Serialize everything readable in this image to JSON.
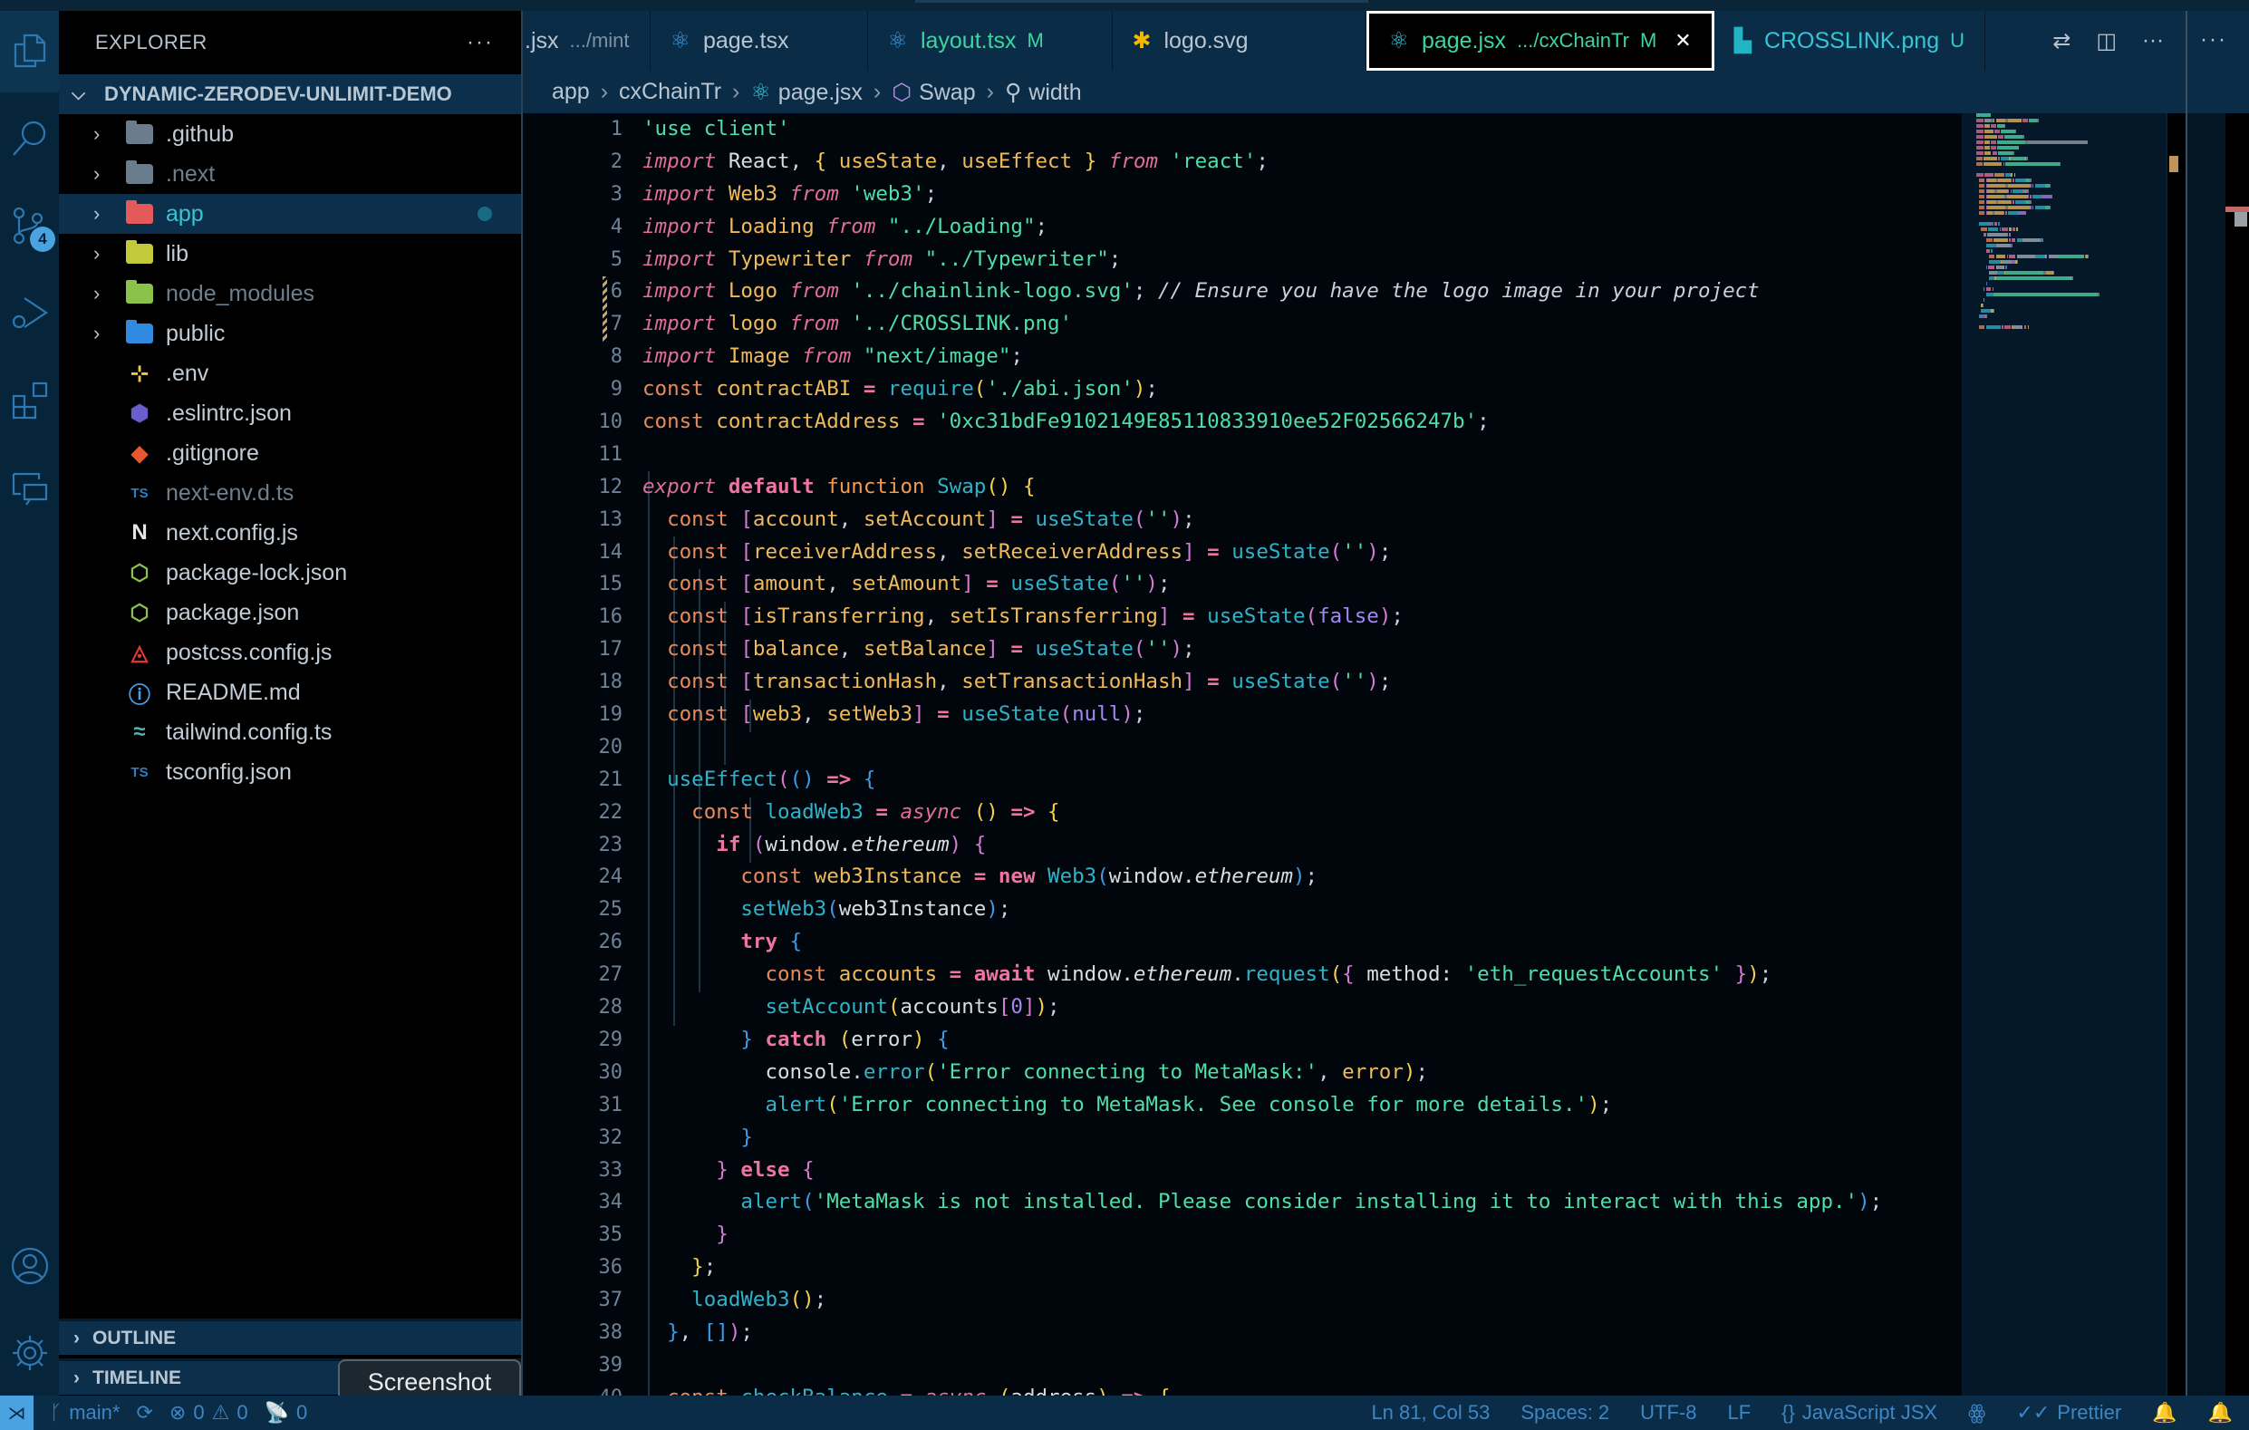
{
  "activity_bar": {
    "items": [
      {
        "name": "explorer",
        "active": true
      },
      {
        "name": "search",
        "active": false
      },
      {
        "name": "source-control",
        "active": false,
        "badge": "4"
      },
      {
        "name": "run-debug",
        "active": false
      },
      {
        "name": "extensions",
        "active": false
      },
      {
        "name": "remote-explorer",
        "active": false
      }
    ],
    "bottom": [
      "accounts",
      "manage"
    ]
  },
  "sidebar": {
    "title": "EXPLORER",
    "more": "···",
    "project": "DYNAMIC-ZERODEV-UNLIMIT-DEMO",
    "tree": [
      {
        "name": ".github",
        "type": "folder",
        "icon": "github-folder-icon",
        "color": "#6b7d8c",
        "dim": false
      },
      {
        "name": ".next",
        "type": "folder",
        "icon": "next-folder-icon",
        "color": "#6b7d8c",
        "dim": true
      },
      {
        "name": "app",
        "type": "folder",
        "icon": "app-folder-icon",
        "color": "#e45a5a",
        "selected": true,
        "modified_dot": true
      },
      {
        "name": "lib",
        "type": "folder",
        "icon": "lib-folder-icon",
        "color": "#c2c93a"
      },
      {
        "name": "node_modules",
        "type": "folder",
        "icon": "node-folder-icon",
        "color": "#8bc34a",
        "dim": true
      },
      {
        "name": "public",
        "type": "folder",
        "icon": "public-folder-icon",
        "color": "#2f8ae0"
      },
      {
        "name": ".env",
        "type": "file",
        "icon": "env-icon",
        "color": "#f5c542"
      },
      {
        "name": ".eslintrc.json",
        "type": "file",
        "icon": "eslint-icon",
        "color": "#6a5ecf"
      },
      {
        "name": ".gitignore",
        "type": "file",
        "icon": "git-icon",
        "color": "#e8572d"
      },
      {
        "name": "next-env.d.ts",
        "type": "file",
        "icon": "typescript-icon",
        "color": "#2f7fc1",
        "dim": true
      },
      {
        "name": "next.config.js",
        "type": "file",
        "icon": "nextjs-icon",
        "color": "#e6e6e6"
      },
      {
        "name": "package-lock.json",
        "type": "file",
        "icon": "nodejs-icon",
        "color": "#8bc34a"
      },
      {
        "name": "package.json",
        "type": "file",
        "icon": "nodejs-icon",
        "color": "#8bc34a"
      },
      {
        "name": "postcss.config.js",
        "type": "file",
        "icon": "postcss-icon",
        "color": "#e53935"
      },
      {
        "name": "README.md",
        "type": "file",
        "icon": "info-icon",
        "color": "#42a5f5"
      },
      {
        "name": "tailwind.config.ts",
        "type": "file",
        "icon": "tailwind-icon",
        "color": "#4db6ac"
      },
      {
        "name": "tsconfig.json",
        "type": "file",
        "icon": "tsconfig-icon",
        "color": "#2f7fc1"
      }
    ],
    "sections": [
      "OUTLINE",
      "TIMELINE"
    ]
  },
  "tabs": [
    {
      "label": ".jsx",
      "desc": ".../mint",
      "icon": "none",
      "color": "#b9c5d0"
    },
    {
      "label": "page.tsx",
      "desc": "",
      "icon": "react-icon",
      "color": "#b9c5d0"
    },
    {
      "label": "layout.tsx",
      "desc": "",
      "mark": "M",
      "icon": "react-icon",
      "color": "#3ed4a0"
    },
    {
      "label": "logo.svg",
      "desc": "",
      "icon": "svg-icon",
      "color": "#b9c5d0"
    },
    {
      "label": "page.jsx",
      "desc": ".../cxChainTr",
      "mark": "M",
      "icon": "react-icon",
      "color": "#3ed4a0",
      "active": true,
      "close": "✕"
    },
    {
      "label": "CROSSLINK.png",
      "desc": "",
      "mark": "U",
      "icon": "image-icon",
      "color": "#37c5d6"
    }
  ],
  "breadcrumb": [
    {
      "label": "app",
      "icon": null
    },
    {
      "label": "cxChainTr",
      "icon": null
    },
    {
      "label": "page.jsx",
      "icon": "react-icon"
    },
    {
      "label": "Swap",
      "icon": "cube-icon"
    },
    {
      "label": "width",
      "icon": "wrench-icon"
    }
  ],
  "editor": {
    "first_line": 1,
    "lines": [
      [
        [
          "str",
          "'use client'"
        ]
      ],
      [
        [
          "k-imp",
          "import"
        ],
        [
          "plain",
          " React"
        ],
        [
          "pun",
          ", "
        ],
        [
          "br1",
          "{"
        ],
        [
          "var",
          " useState"
        ],
        [
          "pun",
          ", "
        ],
        [
          "var",
          "useEffect "
        ],
        [
          "br1",
          "}"
        ],
        [
          "k-imp",
          " from"
        ],
        [
          "str",
          " 'react'"
        ],
        [
          "pun",
          ";"
        ]
      ],
      [
        [
          "k-imp",
          "import"
        ],
        [
          "var",
          " Web3"
        ],
        [
          "k-imp",
          " from"
        ],
        [
          "str",
          " 'web3'"
        ],
        [
          "pun",
          ";"
        ]
      ],
      [
        [
          "k-imp",
          "import"
        ],
        [
          "var",
          " Loading"
        ],
        [
          "k-imp",
          " from"
        ],
        [
          "str",
          " \"../Loading\""
        ],
        [
          "pun",
          ";"
        ]
      ],
      [
        [
          "k-imp",
          "import"
        ],
        [
          "var",
          " Typewriter"
        ],
        [
          "k-imp",
          " from"
        ],
        [
          "str",
          " \"../Typewriter\""
        ],
        [
          "pun",
          ";"
        ]
      ],
      [
        [
          "k-imp",
          "import"
        ],
        [
          "var",
          " Logo"
        ],
        [
          "k-imp",
          " from"
        ],
        [
          "str",
          " '../chainlink-logo.svg'"
        ],
        [
          "pun",
          "; "
        ],
        [
          "cmt",
          "// Ensure you have the logo image in your project"
        ]
      ],
      [
        [
          "k-imp",
          "import"
        ],
        [
          "var",
          " logo"
        ],
        [
          "k-imp",
          " from"
        ],
        [
          "str",
          " '../CROSSLINK.png'"
        ]
      ],
      [
        [
          "k-imp",
          "import"
        ],
        [
          "var",
          " Image"
        ],
        [
          "k-imp",
          " from"
        ],
        [
          "str",
          " \"next/image\""
        ],
        [
          "pun",
          ";"
        ]
      ],
      [
        [
          "k-const",
          "const"
        ],
        [
          "var",
          " contractABI"
        ],
        [
          "k-bold",
          " ="
        ],
        [
          "fn",
          " require"
        ],
        [
          "br1",
          "("
        ],
        [
          "str",
          "'./abi.json'"
        ],
        [
          "br1",
          ")"
        ],
        [
          "pun",
          ";"
        ]
      ],
      [
        [
          "k-const",
          "const"
        ],
        [
          "var",
          " contractAddress"
        ],
        [
          "k-bold",
          " ="
        ],
        [
          "str",
          " '0xc31bdFe9102149E85110833910ee52F02566247b'"
        ],
        [
          "pun",
          ";"
        ]
      ],
      [],
      [
        [
          "k-imp",
          "export"
        ],
        [
          "k-bold",
          " default"
        ],
        [
          "k-fn",
          " function"
        ],
        [
          "cls",
          " Swap"
        ],
        [
          "br1",
          "()"
        ],
        [
          "br1",
          " {"
        ]
      ],
      [
        [
          "k-const",
          "  const"
        ],
        [
          "br2",
          " ["
        ],
        [
          "var",
          "account"
        ],
        [
          "pun",
          ", "
        ],
        [
          "var",
          "setAccount"
        ],
        [
          "br2",
          "]"
        ],
        [
          "k-bold",
          " ="
        ],
        [
          "fn",
          " useState"
        ],
        [
          "br2",
          "("
        ],
        [
          "str",
          "''"
        ],
        [
          "br2",
          ")"
        ],
        [
          "pun",
          ";"
        ]
      ],
      [
        [
          "k-const",
          "  const"
        ],
        [
          "br2",
          " ["
        ],
        [
          "var",
          "receiverAddress"
        ],
        [
          "pun",
          ", "
        ],
        [
          "var",
          "setReceiverAddress"
        ],
        [
          "br2",
          "]"
        ],
        [
          "k-bold",
          " ="
        ],
        [
          "fn",
          " useState"
        ],
        [
          "br2",
          "("
        ],
        [
          "str",
          "''"
        ],
        [
          "br2",
          ")"
        ],
        [
          "pun",
          ";"
        ]
      ],
      [
        [
          "k-const",
          "  const"
        ],
        [
          "br2",
          " ["
        ],
        [
          "var",
          "amount"
        ],
        [
          "pun",
          ", "
        ],
        [
          "var",
          "setAmount"
        ],
        [
          "br2",
          "]"
        ],
        [
          "k-bold",
          " ="
        ],
        [
          "fn",
          " useState"
        ],
        [
          "br2",
          "("
        ],
        [
          "str",
          "''"
        ],
        [
          "br2",
          ")"
        ],
        [
          "pun",
          ";"
        ]
      ],
      [
        [
          "k-const",
          "  const"
        ],
        [
          "br2",
          " ["
        ],
        [
          "var",
          "isTransferring"
        ],
        [
          "pun",
          ", "
        ],
        [
          "var",
          "setIsTransferring"
        ],
        [
          "br2",
          "]"
        ],
        [
          "k-bold",
          " ="
        ],
        [
          "fn",
          " useState"
        ],
        [
          "br2",
          "("
        ],
        [
          "num",
          "false"
        ],
        [
          "br2",
          ")"
        ],
        [
          "pun",
          ";"
        ]
      ],
      [
        [
          "k-const",
          "  const"
        ],
        [
          "br2",
          " ["
        ],
        [
          "var",
          "balance"
        ],
        [
          "pun",
          ", "
        ],
        [
          "var",
          "setBalance"
        ],
        [
          "br2",
          "]"
        ],
        [
          "k-bold",
          " ="
        ],
        [
          "fn",
          " useState"
        ],
        [
          "br2",
          "("
        ],
        [
          "str",
          "''"
        ],
        [
          "br2",
          ")"
        ],
        [
          "pun",
          ";"
        ]
      ],
      [
        [
          "k-const",
          "  const"
        ],
        [
          "br2",
          " ["
        ],
        [
          "var",
          "transactionHash"
        ],
        [
          "pun",
          ", "
        ],
        [
          "var",
          "setTransactionHash"
        ],
        [
          "br2",
          "]"
        ],
        [
          "k-bold",
          " ="
        ],
        [
          "fn",
          " useState"
        ],
        [
          "br2",
          "("
        ],
        [
          "str",
          "''"
        ],
        [
          "br2",
          ")"
        ],
        [
          "pun",
          ";"
        ]
      ],
      [
        [
          "k-const",
          "  const"
        ],
        [
          "br2",
          " ["
        ],
        [
          "var",
          "web3"
        ],
        [
          "pun",
          ", "
        ],
        [
          "var",
          "setWeb3"
        ],
        [
          "br2",
          "]"
        ],
        [
          "k-bold",
          " ="
        ],
        [
          "fn",
          " useState"
        ],
        [
          "br2",
          "("
        ],
        [
          "num",
          "null"
        ],
        [
          "br2",
          ")"
        ],
        [
          "pun",
          ";"
        ]
      ],
      [],
      [
        [
          "fn",
          "  useEffect"
        ],
        [
          "br2",
          "("
        ],
        [
          "br3",
          "()"
        ],
        [
          "k-bold",
          " =>"
        ],
        [
          "br3",
          " {"
        ]
      ],
      [
        [
          "k-const",
          "    const"
        ],
        [
          "fn",
          " loadWeb3"
        ],
        [
          "k-bold",
          " ="
        ],
        [
          "k-imp",
          " async"
        ],
        [
          "br1",
          " ()"
        ],
        [
          "k-bold",
          " =>"
        ],
        [
          "br1",
          " {"
        ]
      ],
      [
        [
          "k-bold",
          "      if"
        ],
        [
          "br2",
          " ("
        ],
        [
          "plain",
          "window."
        ],
        [
          "plain it",
          "ethereum"
        ],
        [
          "br2",
          ")"
        ],
        [
          "br2",
          " {"
        ]
      ],
      [
        [
          "k-const",
          "        const"
        ],
        [
          "var",
          " web3Instance"
        ],
        [
          "k-bold",
          " ="
        ],
        [
          "k-bold",
          " new"
        ],
        [
          "cls",
          " Web3"
        ],
        [
          "br3",
          "("
        ],
        [
          "plain",
          "window."
        ],
        [
          "plain it",
          "ethereum"
        ],
        [
          "br3",
          ")"
        ],
        [
          "pun",
          ";"
        ]
      ],
      [
        [
          "fn",
          "        setWeb3"
        ],
        [
          "br3",
          "("
        ],
        [
          "plain",
          "web3Instance"
        ],
        [
          "br3",
          ")"
        ],
        [
          "pun",
          ";"
        ]
      ],
      [
        [
          "k-bold",
          "        try"
        ],
        [
          "br3",
          " {"
        ]
      ],
      [
        [
          "k-const",
          "          const"
        ],
        [
          "var",
          " accounts"
        ],
        [
          "k-bold",
          " ="
        ],
        [
          "k-bold",
          " await"
        ],
        [
          "plain",
          " window."
        ],
        [
          "plain it",
          "ethereum"
        ],
        [
          "pun",
          "."
        ],
        [
          "fn",
          "request"
        ],
        [
          "br1",
          "("
        ],
        [
          "br2",
          "{"
        ],
        [
          "plain",
          " method: "
        ],
        [
          "str",
          "'eth_requestAccounts'"
        ],
        [
          "br2",
          " }"
        ],
        [
          "br1",
          ")"
        ],
        [
          "pun",
          ";"
        ]
      ],
      [
        [
          "fn",
          "          setAccount"
        ],
        [
          "br1",
          "("
        ],
        [
          "plain",
          "accounts"
        ],
        [
          "br2",
          "["
        ],
        [
          "num",
          "0"
        ],
        [
          "br2",
          "]"
        ],
        [
          "br1",
          ")"
        ],
        [
          "pun",
          ";"
        ]
      ],
      [
        [
          "br3",
          "        }"
        ],
        [
          "k-bold",
          " catch"
        ],
        [
          "br1",
          " ("
        ],
        [
          "plain",
          "error"
        ],
        [
          "br1",
          ")"
        ],
        [
          "br3",
          " {"
        ]
      ],
      [
        [
          "plain",
          "          console"
        ],
        [
          "pun",
          "."
        ],
        [
          "fn",
          "error"
        ],
        [
          "br1",
          "("
        ],
        [
          "str",
          "'Error connecting to MetaMask:'"
        ],
        [
          "pun",
          ", "
        ],
        [
          "var",
          "error"
        ],
        [
          "br1",
          ")"
        ],
        [
          "pun",
          ";"
        ]
      ],
      [
        [
          "fn",
          "          alert"
        ],
        [
          "br1",
          "("
        ],
        [
          "str",
          "'Error connecting to MetaMask. See console for more details.'"
        ],
        [
          "br1",
          ")"
        ],
        [
          "pun",
          ";"
        ]
      ],
      [
        [
          "br3",
          "        }"
        ]
      ],
      [
        [
          "br2",
          "      }"
        ],
        [
          "k-bold",
          " else"
        ],
        [
          "br2",
          " {"
        ]
      ],
      [
        [
          "fn",
          "        alert"
        ],
        [
          "br3",
          "("
        ],
        [
          "str",
          "'MetaMask is not installed. Please consider installing it to interact with this app.'"
        ],
        [
          "br3",
          ")"
        ],
        [
          "pun",
          ";"
        ]
      ],
      [
        [
          "br2",
          "      }"
        ]
      ],
      [
        [
          "br1",
          "    }"
        ],
        [
          "pun",
          ";"
        ]
      ],
      [
        [
          "fn",
          "    loadWeb3"
        ],
        [
          "br1",
          "()"
        ],
        [
          "pun",
          ";"
        ]
      ],
      [
        [
          "br3",
          "  }"
        ],
        [
          "pun",
          ", "
        ],
        [
          "br3",
          "["
        ],
        [
          "br3",
          "]"
        ],
        [
          "br2",
          ")"
        ],
        [
          "pun",
          ";"
        ]
      ],
      [],
      [
        [
          "k-const",
          "  const"
        ],
        [
          "fn",
          " checkBalance"
        ],
        [
          "k-bold",
          " ="
        ],
        [
          "k-imp",
          " async"
        ],
        [
          "br1",
          " ("
        ],
        [
          "plain",
          "address"
        ],
        [
          "br1",
          ")"
        ],
        [
          "k-bold",
          " =>"
        ],
        [
          "br1",
          " {"
        ]
      ]
    ]
  },
  "tooltip": "Screenshot",
  "statusbar": {
    "branch": "main*",
    "errors": "0",
    "warnings": "0",
    "ports": "0",
    "position": "Ln 81, Col 53",
    "spaces": "Spaces: 2",
    "encoding": "UTF-8",
    "eol": "LF",
    "language": "JavaScript JSX",
    "formatter": "Prettier"
  }
}
